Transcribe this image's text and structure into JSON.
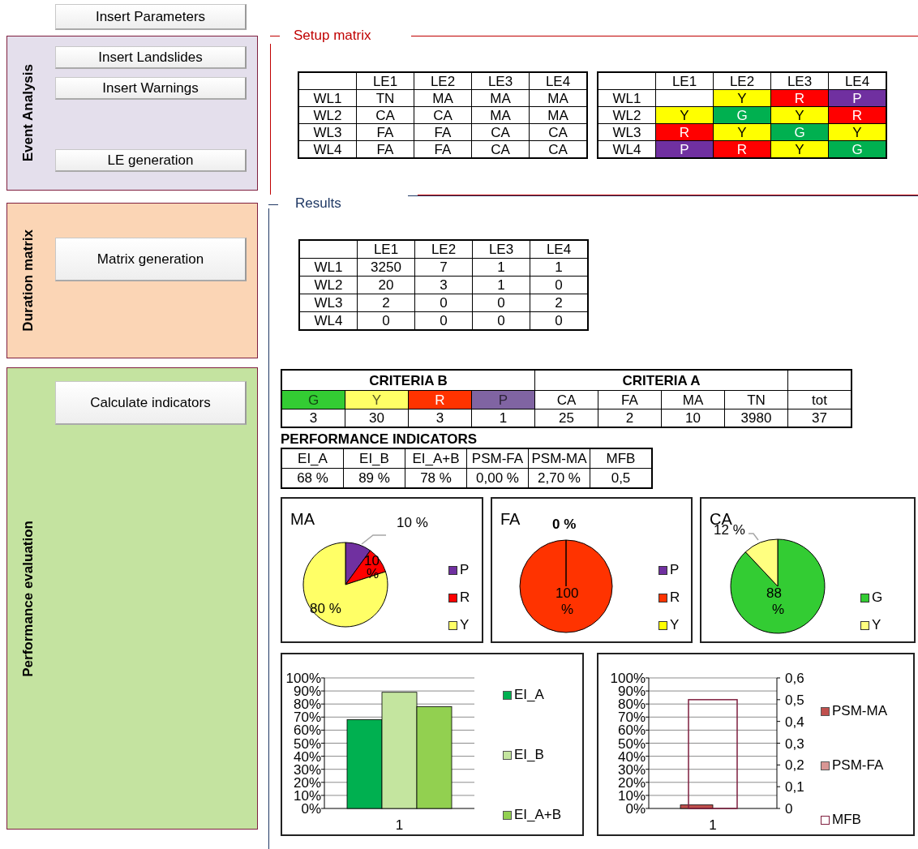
{
  "sidebar": {
    "top_button": "Insert Parameters",
    "panels": [
      {
        "kind": "event",
        "title": "Event Analysis",
        "color": "#e4dfec",
        "buttons": [
          "Insert Landslides",
          "Insert Warnings",
          "LE generation"
        ]
      },
      {
        "kind": "duration",
        "title": "Duration matrix",
        "color": "#fbd5b5",
        "buttons": [
          "Matrix generation"
        ]
      },
      {
        "kind": "performance",
        "title": "Performance evaluation",
        "color": "#c4e3a0",
        "buttons": [
          "Calculate indicators"
        ]
      }
    ]
  },
  "setup": {
    "title": "Setup matrix",
    "event_matrix": {
      "columns": [
        "LE1",
        "LE2",
        "LE3",
        "LE4"
      ],
      "rows": [
        {
          "label": "WL1",
          "cells": [
            "TN",
            "MA",
            "MA",
            "MA"
          ]
        },
        {
          "label": "WL2",
          "cells": [
            "CA",
            "CA",
            "MA",
            "MA"
          ]
        },
        {
          "label": "WL3",
          "cells": [
            "FA",
            "FA",
            "CA",
            "CA"
          ]
        },
        {
          "label": "WL4",
          "cells": [
            "FA",
            "FA",
            "CA",
            "CA"
          ]
        }
      ]
    },
    "warning_matrix": {
      "columns": [
        "LE1",
        "LE2",
        "LE3",
        "LE4"
      ],
      "rows": [
        {
          "label": "WL1",
          "cells": [
            {
              "color": "#ffffff"
            },
            {
              "text": "Y",
              "color": "#ffff00"
            },
            {
              "text": "R",
              "color": "#ff0000"
            },
            {
              "text": "P",
              "color": "#7030a0"
            }
          ]
        },
        {
          "label": "WL2",
          "cells": [
            {
              "text": "Y",
              "color": "#ffff00"
            },
            {
              "text": "G",
              "color": "#00b050"
            },
            {
              "text": "Y",
              "color": "#ffff00"
            },
            {
              "text": "R",
              "color": "#ff0000"
            }
          ]
        },
        {
          "label": "WL3",
          "cells": [
            {
              "text": "R",
              "color": "#ff0000"
            },
            {
              "text": "Y",
              "color": "#ffff00"
            },
            {
              "text": "G",
              "color": "#00b050"
            },
            {
              "text": "Y",
              "color": "#ffff00"
            }
          ]
        },
        {
          "label": "WL4",
          "cells": [
            {
              "text": "P",
              "color": "#7030a0"
            },
            {
              "text": "R",
              "color": "#ff0000"
            },
            {
              "text": "Y",
              "color": "#ffff00"
            },
            {
              "text": "G",
              "color": "#00b050"
            }
          ]
        }
      ]
    }
  },
  "results": {
    "title": "Results",
    "duration_matrix": {
      "columns": [
        "LE1",
        "LE2",
        "LE3",
        "LE4"
      ],
      "rows": [
        {
          "label": "WL1",
          "cells": [
            "3250",
            "7",
            "1",
            "1"
          ]
        },
        {
          "label": "WL2",
          "cells": [
            "20",
            "3",
            "1",
            "0"
          ]
        },
        {
          "label": "WL3",
          "cells": [
            "2",
            "0",
            "0",
            "2"
          ]
        },
        {
          "label": "WL4",
          "cells": [
            "0",
            "0",
            "0",
            "0"
          ]
        }
      ]
    },
    "criteria": {
      "groups": [
        {
          "title": "CRITERIA B",
          "items": [
            {
              "label": "G",
              "color": "#33cc33",
              "value": "3"
            },
            {
              "label": "Y",
              "color": "#ffff66",
              "value": "30"
            },
            {
              "label": "R",
              "color": "#ff3300",
              "value": "3"
            },
            {
              "label": "P",
              "color": "#8064a2",
              "value": "1"
            }
          ]
        },
        {
          "title": "CRITERIA A",
          "items": [
            {
              "label": "CA",
              "color": "#ffffff",
              "value": "25"
            },
            {
              "label": "FA",
              "color": "#ffffff",
              "value": "2"
            },
            {
              "label": "MA",
              "color": "#ffffff",
              "value": "10"
            },
            {
              "label": "TN",
              "color": "#ffffff",
              "value": "3980"
            }
          ]
        },
        {
          "items": [
            {
              "label": "tot",
              "color": "#ffffff",
              "value": "37"
            }
          ]
        }
      ]
    },
    "performance_indicators": {
      "title": "PERFORMANCE INDICATORS",
      "columns": [
        "EI_A",
        "EI_B",
        "EI_A+B",
        "PSM-FA",
        "PSM-MA",
        "MFB"
      ],
      "values": [
        "68 %",
        "89 %",
        "78 %",
        "0,00 %",
        "2,70 %",
        "0,5"
      ]
    },
    "pie_charts": [
      {
        "chart_data": {
          "type": "pie",
          "title": "MA",
          "categories": [
            "P",
            "R",
            "Y"
          ],
          "values": [
            10,
            10,
            80
          ],
          "colors": [
            "#7030a0",
            "#ff0000",
            "#ffff66"
          ],
          "value_labels": [
            "10 %",
            "10 %",
            "80 %"
          ]
        }
      },
      {
        "chart_data": {
          "type": "pie",
          "title": "FA",
          "categories": [
            "P",
            "R",
            "Y"
          ],
          "values": [
            0,
            100,
            0
          ],
          "colors": [
            "#7030a0",
            "#ff3300",
            "#ffff00"
          ],
          "value_labels": [
            "0 %",
            "100 %",
            null
          ]
        }
      },
      {
        "chart_data": {
          "type": "pie",
          "title": "CA",
          "categories": [
            "G",
            "Y"
          ],
          "values": [
            88,
            12
          ],
          "colors": [
            "#33cc33",
            "#ffff80"
          ],
          "value_labels": [
            "88 %",
            "12 %"
          ]
        }
      }
    ],
    "bar_charts": [
      {
        "chart_data": {
          "type": "bar",
          "categories": [
            "1"
          ],
          "ylim": [
            0,
            1
          ],
          "grid": true,
          "yticks": [
            {
              "value": 0,
              "label": "0%"
            },
            {
              "value": 0.1,
              "label": "10%"
            },
            {
              "value": 0.2,
              "label": "20%"
            },
            {
              "value": 0.3,
              "label": "30%"
            },
            {
              "value": 0.4,
              "label": "40%"
            },
            {
              "value": 0.5,
              "label": "50%"
            },
            {
              "value": 0.6,
              "label": "60%"
            },
            {
              "value": 0.7,
              "label": "70%"
            },
            {
              "value": 0.8,
              "label": "80%"
            },
            {
              "value": 0.9,
              "label": "90%"
            },
            {
              "value": 1,
              "label": "100%"
            }
          ],
          "series": [
            {
              "name": "EI_A",
              "color": "#00b050",
              "values": [
                0.68
              ]
            },
            {
              "name": "EI_B",
              "color": "#c4e59f",
              "values": [
                0.89
              ]
            },
            {
              "name": "EI_A+B",
              "color": "#92d050",
              "values": [
                0.78
              ]
            }
          ]
        }
      },
      {
        "chart_data": {
          "type": "bar",
          "categories": [
            "1"
          ],
          "ylim": [
            0,
            1
          ],
          "y2lim": [
            0,
            0.6
          ],
          "grid": true,
          "yticks": [
            {
              "value": 0,
              "label": "0%"
            },
            {
              "value": 0.1,
              "label": "10%"
            },
            {
              "value": 0.2,
              "label": "20%"
            },
            {
              "value": 0.3,
              "label": "30%"
            },
            {
              "value": 0.4,
              "label": "40%"
            },
            {
              "value": 0.5,
              "label": "50%"
            },
            {
              "value": 0.6,
              "label": "60%"
            },
            {
              "value": 0.7,
              "label": "70%"
            },
            {
              "value": 0.8,
              "label": "80%"
            },
            {
              "value": 0.9,
              "label": "90%"
            },
            {
              "value": 1,
              "label": "100%"
            }
          ],
          "y2ticks": [
            {
              "value": 0,
              "label": "0"
            },
            {
              "value": 0.1,
              "label": "0,1"
            },
            {
              "value": 0.2,
              "label": "0,2"
            },
            {
              "value": 0.3,
              "label": "0,3"
            },
            {
              "value": 0.4,
              "label": "0,4"
            },
            {
              "value": 0.5,
              "label": "0,5"
            },
            {
              "value": 0.6,
              "label": "0,6"
            }
          ],
          "series": [
            {
              "name": "PSM-MA",
              "color": "#c0504d",
              "values": [
                0.027
              ]
            },
            {
              "name": "PSM-FA",
              "color": "#d99694",
              "values": [
                0
              ]
            },
            {
              "name": "MFB",
              "color": "#7f1f3f",
              "values": [
                0.5
              ],
              "axis": "y2"
            }
          ]
        }
      }
    ]
  }
}
